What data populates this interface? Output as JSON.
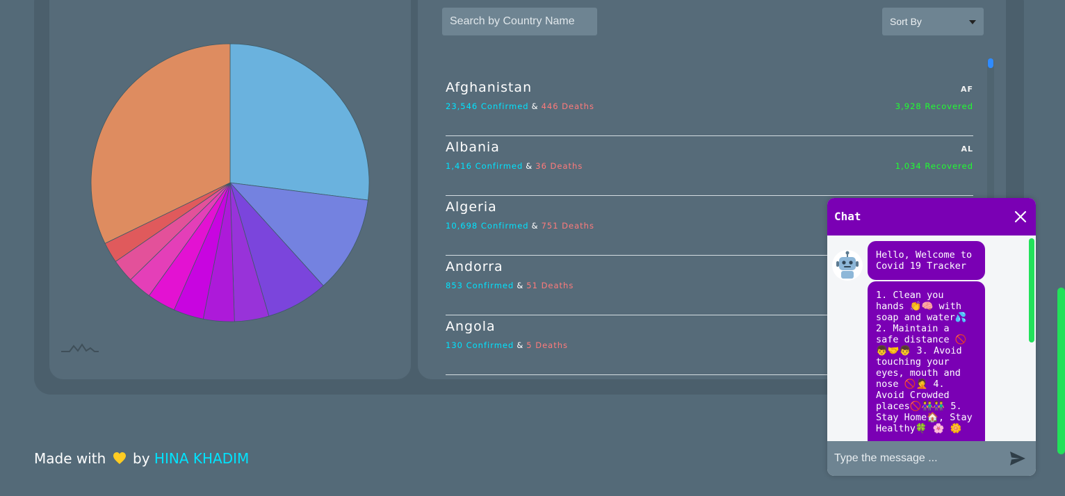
{
  "search": {
    "placeholder": "Search by Country Name"
  },
  "sort": {
    "selected": "Sort By"
  },
  "countries": [
    {
      "name": "Afghanistan",
      "code": "AF",
      "confirmed": "23,546 Confirmed",
      "deaths": "446 Deaths",
      "recovered": "3,928 Recovered"
    },
    {
      "name": "Albania",
      "code": "AL",
      "confirmed": "1,416 Confirmed",
      "deaths": "36 Deaths",
      "recovered": "1,034 Recovered"
    },
    {
      "name": "Algeria",
      "confirmed": "10,698 Confirmed",
      "deaths": "751 Deaths"
    },
    {
      "name": "Andorra",
      "confirmed": "853 Confirmed",
      "deaths": "51 Deaths"
    },
    {
      "name": "Angola",
      "confirmed": "130 Confirmed",
      "deaths": "5 Deaths"
    }
  ],
  "amp": "&",
  "chart_data": {
    "type": "pie",
    "slices": [
      {
        "value": 27.0,
        "color": "#6ab2de"
      },
      {
        "value": 11.3,
        "color": "#7482e0"
      },
      {
        "value": 7.2,
        "color": "#7b45dc"
      },
      {
        "value": 4.0,
        "color": "#9833d9"
      },
      {
        "value": 3.6,
        "color": "#ad1ad9"
      },
      {
        "value": 3.5,
        "color": "#c805e0"
      },
      {
        "value": 3.3,
        "color": "#e312d2"
      },
      {
        "value": 2.8,
        "color": "#e43fb8"
      },
      {
        "value": 2.7,
        "color": "#e3519a"
      },
      {
        "value": 2.4,
        "color": "#e05a5c"
      },
      {
        "value": 32.2,
        "color": "#de8c60"
      }
    ]
  },
  "footer": {
    "prefix": "Made with",
    "by": "by",
    "author": "HINA KHADIM"
  },
  "chat": {
    "title": "Chat",
    "messages": [
      "Hello, Welcome to Covid 19 Tracker",
      "1. Clean you hands 👏🧠 with soap and water💦 2. Maintain a safe distance 🚫 👦🤝👦 3. Avoid touching your eyes, mouth and nose 🚫🤦 4. Avoid Crowded places🚫👫👫 5. Stay Home🏠, Stay Healthy🍀 🌸 🌼"
    ],
    "input_placeholder": "Type the message ..."
  },
  "colors": {
    "accent": "#7a00b4",
    "confirmed": "#00e4ff",
    "deaths": "#ff7b7b",
    "recovered": "#20ff30"
  }
}
